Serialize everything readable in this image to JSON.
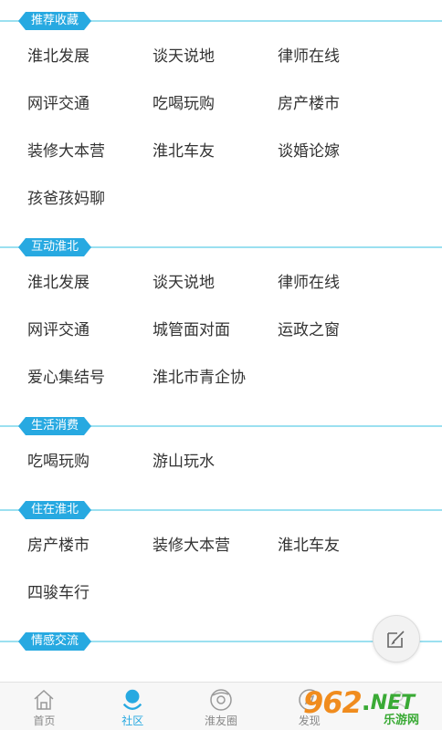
{
  "sections": [
    {
      "title": "推荐收藏",
      "items": [
        "淮北发展",
        "谈天说地",
        "律师在线",
        "网评交通",
        "吃喝玩购",
        "房产楼市",
        "装修大本营",
        "淮北车友",
        "谈婚论嫁",
        "孩爸孩妈聊"
      ]
    },
    {
      "title": "互动淮北",
      "items": [
        "淮北发展",
        "谈天说地",
        "律师在线",
        "网评交通",
        "城管面对面",
        "运政之窗",
        "爱心集结号",
        "淮北市青企协"
      ]
    },
    {
      "title": "生活消费",
      "items": [
        "吃喝玩购",
        "游山玩水"
      ]
    },
    {
      "title": "住在淮北",
      "items": [
        "房产楼市",
        "装修大本营",
        "淮北车友",
        "四骏车行"
      ]
    },
    {
      "title": "情感交流",
      "items": []
    }
  ],
  "fab": {
    "icon": "edit-icon"
  },
  "tabbar": {
    "active_color": "#27a9e1",
    "tabs": [
      {
        "label": "首页",
        "icon": "home-icon"
      },
      {
        "label": "社区",
        "icon": "community-icon",
        "active": true
      },
      {
        "label": "淮友圈",
        "icon": "friends-circle-icon"
      },
      {
        "label": "发现",
        "icon": "discover-icon"
      },
      {
        "label": "",
        "icon": "me-icon"
      }
    ]
  },
  "watermark": {
    "number": "962",
    "dot": ".",
    "net": "NET",
    "subtitle": "乐游网"
  }
}
